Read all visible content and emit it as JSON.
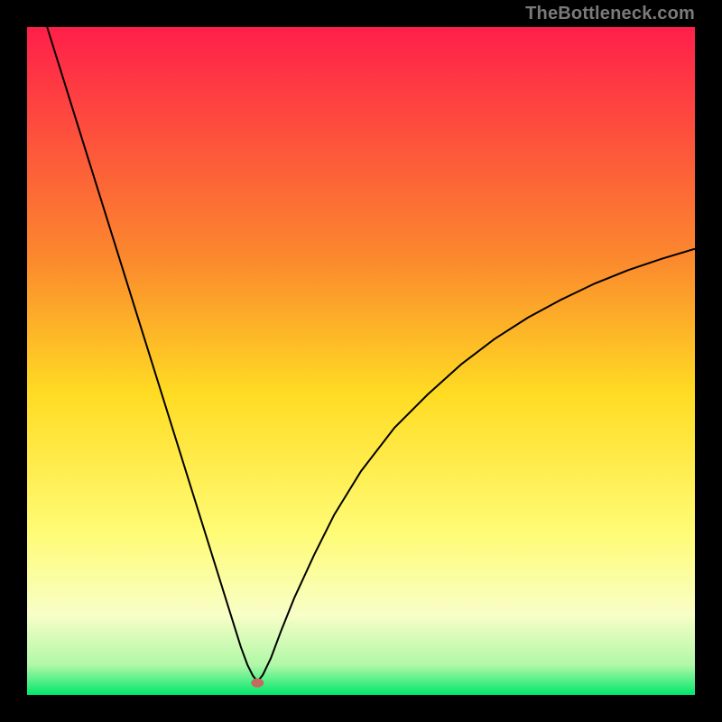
{
  "watermark": "TheBottleneck.com",
  "chart_data": {
    "type": "line",
    "title": "",
    "xlabel": "",
    "ylabel": "",
    "xlim": [
      0,
      100
    ],
    "ylim": [
      0,
      100
    ],
    "background_gradient": {
      "stops": [
        {
          "offset": 0.0,
          "color": "#ff1f4a"
        },
        {
          "offset": 0.35,
          "color": "#fb8a2d"
        },
        {
          "offset": 0.55,
          "color": "#ffdc23"
        },
        {
          "offset": 0.76,
          "color": "#fffc77"
        },
        {
          "offset": 0.88,
          "color": "#f8fec7"
        },
        {
          "offset": 0.955,
          "color": "#b1f8a8"
        },
        {
          "offset": 1.0,
          "color": "#00e76c"
        }
      ]
    },
    "marker": {
      "x": 34.5,
      "y": 1.8,
      "color": "#c46a5e",
      "rx": 7,
      "ry": 5
    },
    "series": [
      {
        "name": "curve",
        "color": "#000000",
        "width": 2,
        "x": [
          3.0,
          5,
          8,
          11,
          14,
          17,
          20,
          23,
          26,
          29,
          30.5,
          32,
          33,
          33.8,
          34.5,
          35.3,
          36.5,
          38,
          40,
          43,
          46,
          50,
          55,
          60,
          65,
          70,
          75,
          80,
          85,
          90,
          95,
          100
        ],
        "y": [
          100,
          93.6,
          84.0,
          74.4,
          64.8,
          55.2,
          45.6,
          36.0,
          26.4,
          16.8,
          12.0,
          7.2,
          4.5,
          2.9,
          2.0,
          3.0,
          5.5,
          9.5,
          14.5,
          21.0,
          27.0,
          33.5,
          40.0,
          45.0,
          49.5,
          53.3,
          56.5,
          59.2,
          61.6,
          63.6,
          65.3,
          66.8
        ]
      }
    ]
  }
}
